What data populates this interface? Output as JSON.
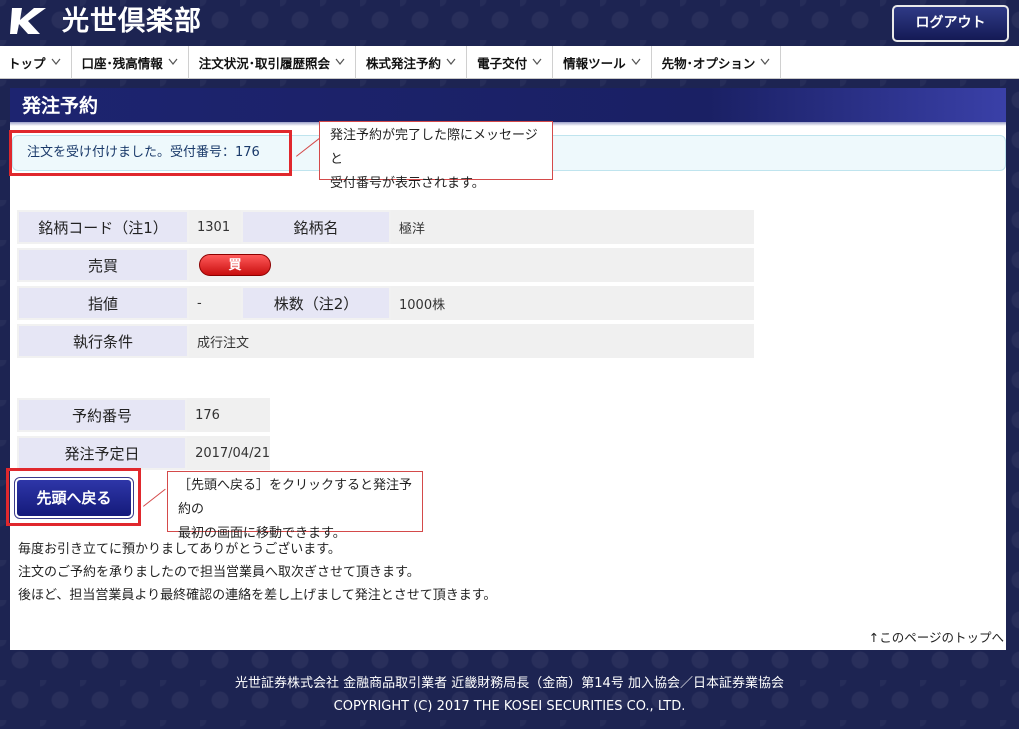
{
  "header": {
    "brand": "光世倶楽部",
    "logout_label": "ログアウト"
  },
  "nav": {
    "items": [
      {
        "label": "トップ"
      },
      {
        "label": "口座･残高情報"
      },
      {
        "label": "注文状況･取引履歴照会"
      },
      {
        "label": "株式発注予約"
      },
      {
        "label": "電子交付"
      },
      {
        "label": "情報ツール"
      },
      {
        "label": "先物･オプション"
      }
    ]
  },
  "page": {
    "title": "発注予約",
    "message": "注文を受け付けました。受付番号：176"
  },
  "callouts": {
    "message": [
      "発注予約が完了した際にメッセージと",
      "受付番号が表示されます。"
    ],
    "back": [
      "［先頭へ戻る］をクリックすると発注予約の",
      "最初の画面に移動できます。"
    ]
  },
  "order": {
    "code_label": "銘柄コード（注1）",
    "code_value": "1301",
    "name_label": "銘柄名",
    "name_value": "極洋",
    "side_label": "売買",
    "side_value": "買",
    "price_label": "指値",
    "price_value": "-",
    "qty_label": "株数（注2）",
    "qty_value": "1000株",
    "cond_label": "執行条件",
    "cond_value": "成行注文"
  },
  "reservation": {
    "no_label": "予約番号",
    "no_value": "176",
    "date_label": "発注予定日",
    "date_value": "2017/04/21"
  },
  "back_button": "先頭へ戻る",
  "notes": [
    "毎度お引き立てに預かりましてありがとうございます。",
    "注文のご予約を承りましたので担当営業員へ取次ぎさせて頂きます。",
    "後ほど、担当営業員より最終確認の連絡を差し上げまして発注とさせて頂きます。"
  ],
  "page_top": "↑このページのトップへ",
  "footer": {
    "line1": "光世証券株式会社  金融商品取引業者  近畿財務局長（金商）第14号  加入協会／日本証券業協会",
    "line2": "COPYRIGHT (C) 2017 THE KOSEI SECURITIES CO., LTD."
  },
  "icons": {
    "logo": "k-logo-icon",
    "caret": "chevron-down-icon"
  },
  "colors": {
    "background": "#1d2452",
    "title_bar": "#1d2470",
    "highlight": "#e0282d",
    "buy": "#d81818"
  }
}
